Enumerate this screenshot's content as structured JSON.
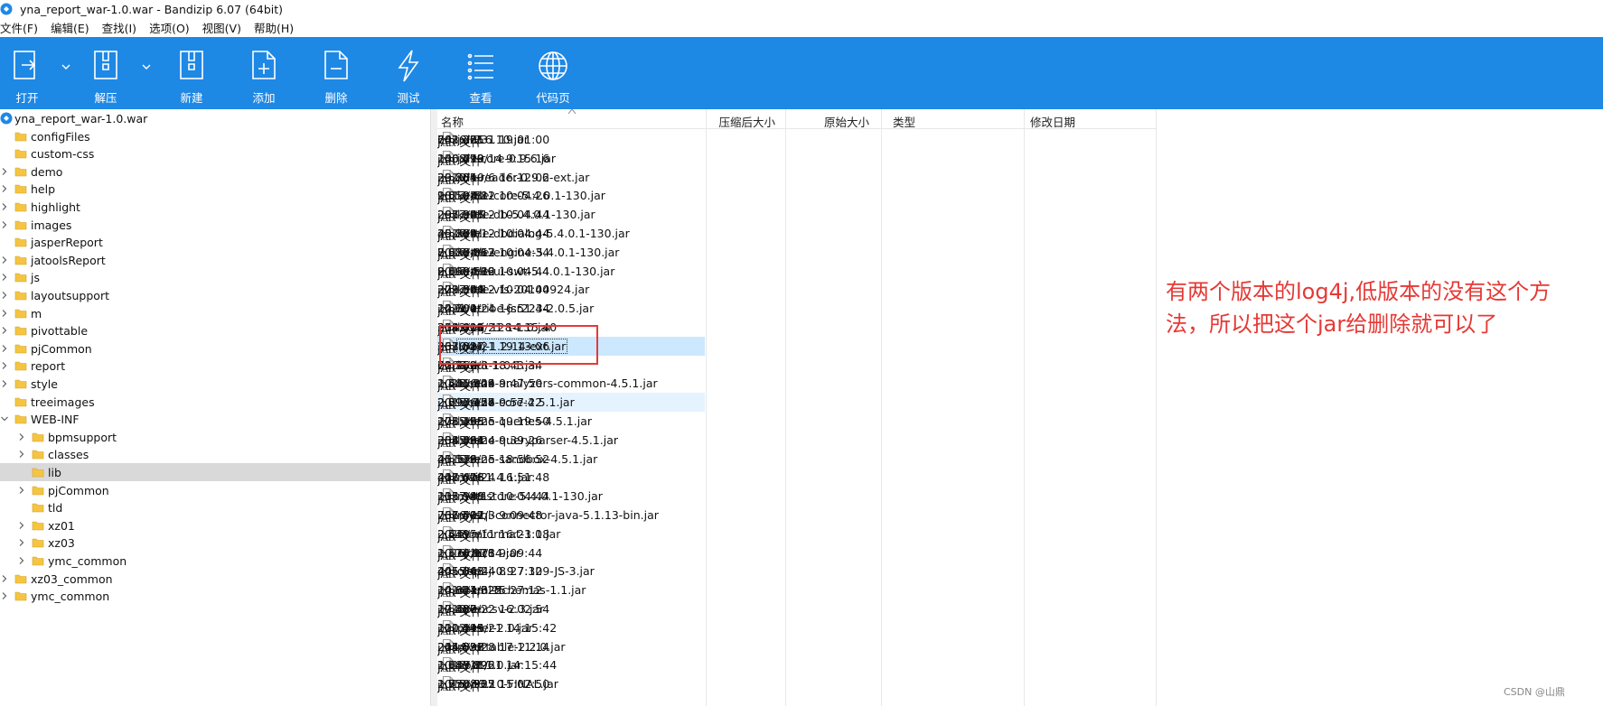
{
  "window": {
    "title": "yna_report_war-1.0.war - Bandizip 6.07 (64bit)"
  },
  "menu": [
    "文件(F)",
    "编辑(E)",
    "查找(I)",
    "选项(O)",
    "视图(V)",
    "帮助(H)"
  ],
  "toolbar": {
    "open": "打开",
    "extract": "解压",
    "new": "新建",
    "add": "添加",
    "delete": "删除",
    "test": "测试",
    "view": "查看",
    "codepage": "代码页"
  },
  "tree": {
    "root": "yna_report_war-1.0.war",
    "items": [
      {
        "label": "configFiles",
        "level": 1,
        "expander": false
      },
      {
        "label": "custom-css",
        "level": 1,
        "expander": false
      },
      {
        "label": "demo",
        "level": 1,
        "expander": true
      },
      {
        "label": "help",
        "level": 1,
        "expander": true
      },
      {
        "label": "highlight",
        "level": 1,
        "expander": true
      },
      {
        "label": "images",
        "level": 1,
        "expander": true
      },
      {
        "label": "jasperReport",
        "level": 1,
        "expander": false
      },
      {
        "label": "jatoolsReport",
        "level": 1,
        "expander": true
      },
      {
        "label": "js",
        "level": 1,
        "expander": true
      },
      {
        "label": "layoutsupport",
        "level": 1,
        "expander": true
      },
      {
        "label": "m",
        "level": 1,
        "expander": true
      },
      {
        "label": "pivottable",
        "level": 1,
        "expander": true
      },
      {
        "label": "pjCommon",
        "level": 1,
        "expander": true
      },
      {
        "label": "report",
        "level": 1,
        "expander": true
      },
      {
        "label": "style",
        "level": 1,
        "expander": true
      },
      {
        "label": "treeimages",
        "level": 1,
        "expander": false
      },
      {
        "label": "WEB-INF",
        "level": 1,
        "expander": "open"
      },
      {
        "label": "bpmsupport",
        "level": 2,
        "expander": true
      },
      {
        "label": "classes",
        "level": 2,
        "expander": true
      },
      {
        "label": "lib",
        "level": 2,
        "expander": false,
        "selected": true
      },
      {
        "label": "pjCommon",
        "level": 2,
        "expander": true
      },
      {
        "label": "tld",
        "level": 2,
        "expander": false
      },
      {
        "label": "xz01",
        "level": 2,
        "expander": true
      },
      {
        "label": "xz03",
        "level": 2,
        "expander": true
      },
      {
        "label": "ymc_common",
        "level": 2,
        "expander": true
      },
      {
        "label": "xz03_common",
        "level": 1,
        "expander": true
      },
      {
        "label": "ymc_common",
        "level": 1,
        "expander": true
      }
    ]
  },
  "columns": {
    "name": "名称",
    "compressed": "压缩后大小",
    "original": "原始大小",
    "type": "类型",
    "modified": "修改日期"
  },
  "files": [
    {
      "name": "jxl-2.6.10.jar",
      "compressed": "682,225",
      "original": "743,361",
      "type": "JAR 文件",
      "modified": "2016/5/31 19:01:00"
    },
    {
      "name": "jxls-core-0.9.6.jar",
      "compressed": "136,499",
      "original": "146,773",
      "type": "JAR 文件",
      "modified": "2008/10/14 9:15:16"
    },
    {
      "name": "jxls-reader-0.9.6-ext.jar",
      "compressed": "29,765",
      "original": "33,834",
      "type": "JAR 文件",
      "modified": "2010/10/6 16:12:02"
    },
    {
      "name": "kettle-core-5.4.0.1-130.jar",
      "compressed": "981,231",
      "original": "1,050,581",
      "type": "JAR 文件",
      "modified": "2017/4/12 10:04:26"
    },
    {
      "name": "kettle-db-5.4.0.1-130.jar",
      "compressed": "285,925",
      "original": "297,307",
      "type": "JAR 文件",
      "modified": "2017/4/12 10:04:44"
    },
    {
      "name": "kettle-dbdialog-5.4.0.1-130.jar",
      "compressed": "39,763",
      "original": "45,879",
      "type": "JAR 文件",
      "modified": "2017/4/12 10:04:44"
    },
    {
      "name": "kettle-engine-5.4.0.1-130.jar",
      "compressed": "7,976,667",
      "original": "8,687,053",
      "type": "JAR 文件",
      "modified": "2017/4/12 10:04:34"
    },
    {
      "name": "kettle-ui-swt-5.4.0.1-130.jar",
      "compressed": "8,069,536",
      "original": "9,198,569",
      "type": "JAR 文件",
      "modified": "2017/4/12 10:04:44"
    },
    {
      "name": "kettle-vfs-20100924.jar",
      "compressed": "279,530",
      "original": "323,304",
      "type": "JAR 文件",
      "modified": "2017/4/12 10:04:44"
    },
    {
      "name": "livetribe-jsr223-2.0.5.jar",
      "compressed": "12,600",
      "original": "14,704",
      "type": "JAR 文件",
      "modified": "2011/1/24 16:51:44"
    },
    {
      "name": "log4j_128-1.0.jar",
      "compressed": "318,416",
      "original": "354,004",
      "type": "JAR 文件",
      "modified": "2012/11/21 14:15:40"
    },
    {
      "name": "log4j-1.2.14-ext.jar",
      "compressed": "333,817",
      "original": "367,387",
      "type": "JAR 文件",
      "modified": "2010/2/21 19:13:06",
      "state": "selected"
    },
    {
      "name": "logkit-1.0.1.jar",
      "compressed": "61,769",
      "original": "72,150",
      "type": "JAR 文件",
      "modified": "2008/2/8 18:43:34"
    },
    {
      "name": "lucene-analyzers-common-4.5.1.jar",
      "compressed": "1,441,849",
      "original": "1,586,103",
      "type": "JAR 文件",
      "modified": "2015/6/24 9:47:50"
    },
    {
      "name": "lucene-core-4.5.1.jar",
      "compressed": "2,096,158",
      "original": "2,297,477",
      "type": "JAR 文件",
      "modified": "2015/6/24 9:57:22",
      "state": "hover"
    },
    {
      "name": "lucene-queries-4.5.1.jar",
      "compressed": "178,455",
      "original": "205,195",
      "type": "JAR 文件",
      "modified": "2015/6/25 19:19:50"
    },
    {
      "name": "lucene-queryparser-4.5.1.jar",
      "compressed": "338,491",
      "original": "384,884",
      "type": "JAR 文件",
      "modified": "2015/6/24 9:39:26"
    },
    {
      "name": "lucene-sandbox-4.5.1.jar",
      "compressed": "41,119",
      "original": "45,578",
      "type": "JAR 文件",
      "modified": "2015/6/25 18:56:52"
    },
    {
      "name": "mail-1.4.1.jar",
      "compressed": "418,408",
      "original": "447,676",
      "type": "JAR 文件",
      "modified": "2011/1/24 16:51:48"
    },
    {
      "name": "metastore-5.4.0.1-130.jar",
      "compressed": "115,940",
      "original": "133,188",
      "type": "JAR 文件",
      "modified": "2017/4/12 10:04:44"
    },
    {
      "name": "mysql-connector-java-5.1.13-bin.jar",
      "compressed": "736,567",
      "original": "767,492",
      "type": "JAR 文件",
      "modified": "2016/11/3 9:09:48"
    },
    {
      "name": "numformat-1.0.jar",
      "compressed": "2,441",
      "original": "2,539",
      "type": "JAR 文件",
      "modified": "2012/5/11 16:23:18"
    },
    {
      "name": "ojdbc14.jar",
      "compressed": "1,116,118",
      "original": "1,174,976",
      "type": "JAR 文件",
      "modified": "2016/11/3 9:09:44"
    },
    {
      "name": "olap4j-0.9.7.309-JS-3.jar",
      "compressed": "405,643",
      "original": "445,343",
      "type": "JAR 文件",
      "modified": "2015/6/24 8:27:12"
    },
    {
      "name": "ooxml-schemas-1.1.jar",
      "compressed": "10,621,325",
      "original": "14,841,622",
      "type": "JAR 文件",
      "modified": "2014/4/3 15:27:12"
    },
    {
      "name": "opencsv-2.3.jar",
      "compressed": "17,486",
      "original": "19,827",
      "type": "JAR 文件",
      "modified": "2013/9/22 16:02:54"
    },
    {
      "name": "parser-2.0.jar",
      "compressed": "110,449",
      "original": "120,195",
      "type": "JAR 文件",
      "modified": "2012/11/21 14:15:42"
    },
    {
      "name": "pivottable-2.2.0.jar",
      "compressed": "215,837",
      "original": "244,536",
      "type": "JAR 文件",
      "modified": "2014/9/28 17:11:14"
    },
    {
      "name": "poi2-1.0.jar",
      "compressed": "1,049,826",
      "original": "1,187,196",
      "type": "JAR 文件",
      "modified": "2012/11/21 14:15:44"
    },
    {
      "name": "poi-3.10-FINAL.jar",
      "compressed": "1,776,537",
      "original": "1,950,905",
      "type": "JAR 文件",
      "modified": "2015/8/22 15:02:50"
    }
  ],
  "annotation": "有两个版本的log4j,低版本的没有这个方法，所以把这个jar给删除就可以了",
  "watermark": "CSDN @山鼎",
  "colors": {
    "ribbon": "#1e88e5",
    "annotation": "#e53935",
    "folder": "#f5c542"
  }
}
